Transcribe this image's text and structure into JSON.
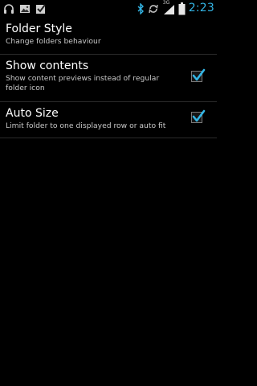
{
  "status_bar": {
    "time": "2:23",
    "network": "3G",
    "left_icons": [
      "headphones-icon",
      "gallery-icon",
      "checkbox-icon"
    ],
    "right_icons": [
      "bluetooth-icon",
      "sync-icon",
      "signal-icon",
      "battery-icon"
    ],
    "accent_color": "#33b5e5"
  },
  "preferences": [
    {
      "title": "Folder Style",
      "summary": "Change folders behaviour",
      "checked": null
    },
    {
      "title": "Show contents",
      "summary": "Show content previews instead of regular folder icon",
      "checked": true
    },
    {
      "title": "Auto Size",
      "summary": "Limit folder to one displayed row or auto fit",
      "checked": true
    }
  ]
}
